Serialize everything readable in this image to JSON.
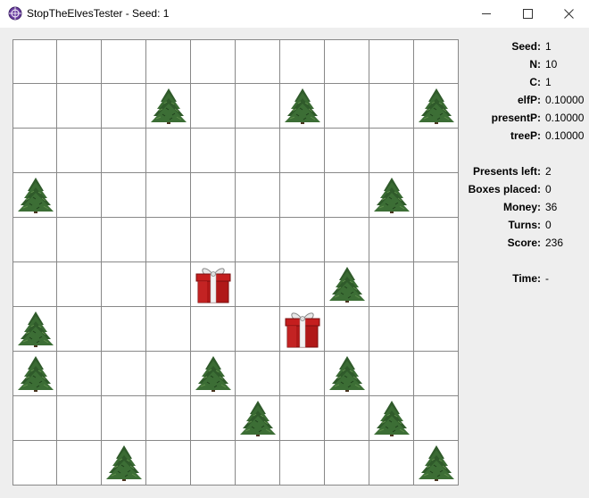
{
  "window": {
    "title": "StopTheElvesTester - Seed: 1"
  },
  "board": {
    "size": 10,
    "cells": [
      "..........",
      "...T..T..T",
      "..........",
      "T.......T.",
      "..........",
      "....P..T..",
      "T.....P...",
      "T...T..T..",
      ".....T..T.",
      "..T......T"
    ],
    "legend": {
      "T": "tree",
      "P": "present",
      ".": "empty"
    }
  },
  "stats": {
    "seed": {
      "label": "Seed:",
      "value": "1"
    },
    "n": {
      "label": "N:",
      "value": "10"
    },
    "c": {
      "label": "C:",
      "value": "1"
    },
    "elfP": {
      "label": "elfP:",
      "value": "0.10000"
    },
    "presentP": {
      "label": "presentP:",
      "value": "0.10000"
    },
    "treeP": {
      "label": "treeP:",
      "value": "0.10000"
    },
    "presents_left": {
      "label": "Presents left:",
      "value": "2"
    },
    "boxes_placed": {
      "label": "Boxes placed:",
      "value": "0"
    },
    "money": {
      "label": "Money:",
      "value": "36"
    },
    "turns": {
      "label": "Turns:",
      "value": "0"
    },
    "score": {
      "label": "Score:",
      "value": "236"
    },
    "time": {
      "label": "Time:",
      "value": "-"
    }
  }
}
